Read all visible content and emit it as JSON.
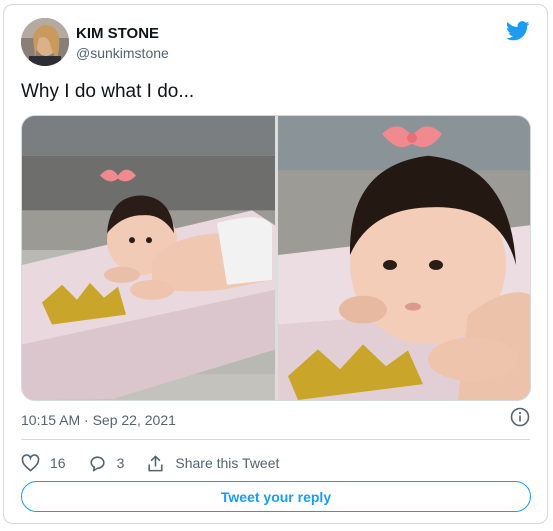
{
  "author": {
    "name": "KIM STONE",
    "handle": "@sunkimstone"
  },
  "tweet": {
    "text": "Why I do what I do..."
  },
  "meta": {
    "timestamp": "10:15 AM · Sep 22, 2021"
  },
  "actions": {
    "likes": "16",
    "replies": "3",
    "share_label": "Share this Tweet"
  },
  "reply_button": {
    "label": "Tweet your reply"
  },
  "colors": {
    "accent": "#1d9bf0",
    "muted": "#536471",
    "border": "#cfd9de"
  },
  "icons": [
    "twitter-bird-icon",
    "info-icon",
    "heart-icon",
    "reply-icon",
    "share-icon"
  ]
}
